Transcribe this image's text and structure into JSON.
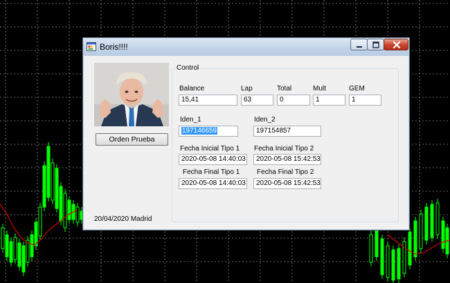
{
  "window": {
    "title": "Boris!!!!"
  },
  "left_panel": {
    "order_button_label": "Orden Prueba",
    "footer_text": "20/04/2020 Madrid"
  },
  "control_group": {
    "title": "Control",
    "fields": {
      "balance": {
        "label": "Balance",
        "value": "15,41"
      },
      "lap": {
        "label": "Lap",
        "value": "63"
      },
      "total": {
        "label": "Total",
        "value": "0"
      },
      "mult": {
        "label": "Mult",
        "value": "1"
      },
      "gem": {
        "label": "GEM",
        "value": "1"
      },
      "iden_1": {
        "label": "Iden_1",
        "value": "197146659"
      },
      "iden_2": {
        "label": "Iden_2",
        "value": "197154857"
      },
      "fecha_inicial_1": {
        "label": "Fecha Inicial Tipo 1",
        "value": "2020-05-08 14:40:03"
      },
      "fecha_inicial_2": {
        "label": "Fecha Inicial Tipo 2",
        "value": "2020-05-08 15:42:53"
      },
      "fecha_final_1": {
        "label": "Fecha Final Tipo 1",
        "value": "2020-05-08 14:40:03"
      },
      "fecha_final_2": {
        "label": "Fecha Final Tipo 2",
        "value": "2020-05-08 15:42:53"
      }
    }
  },
  "colors": {
    "desktop_bg": "#000000",
    "candle_up": "#00ff00",
    "moving_average": "#ff0000",
    "selection": "#3399ff"
  }
}
